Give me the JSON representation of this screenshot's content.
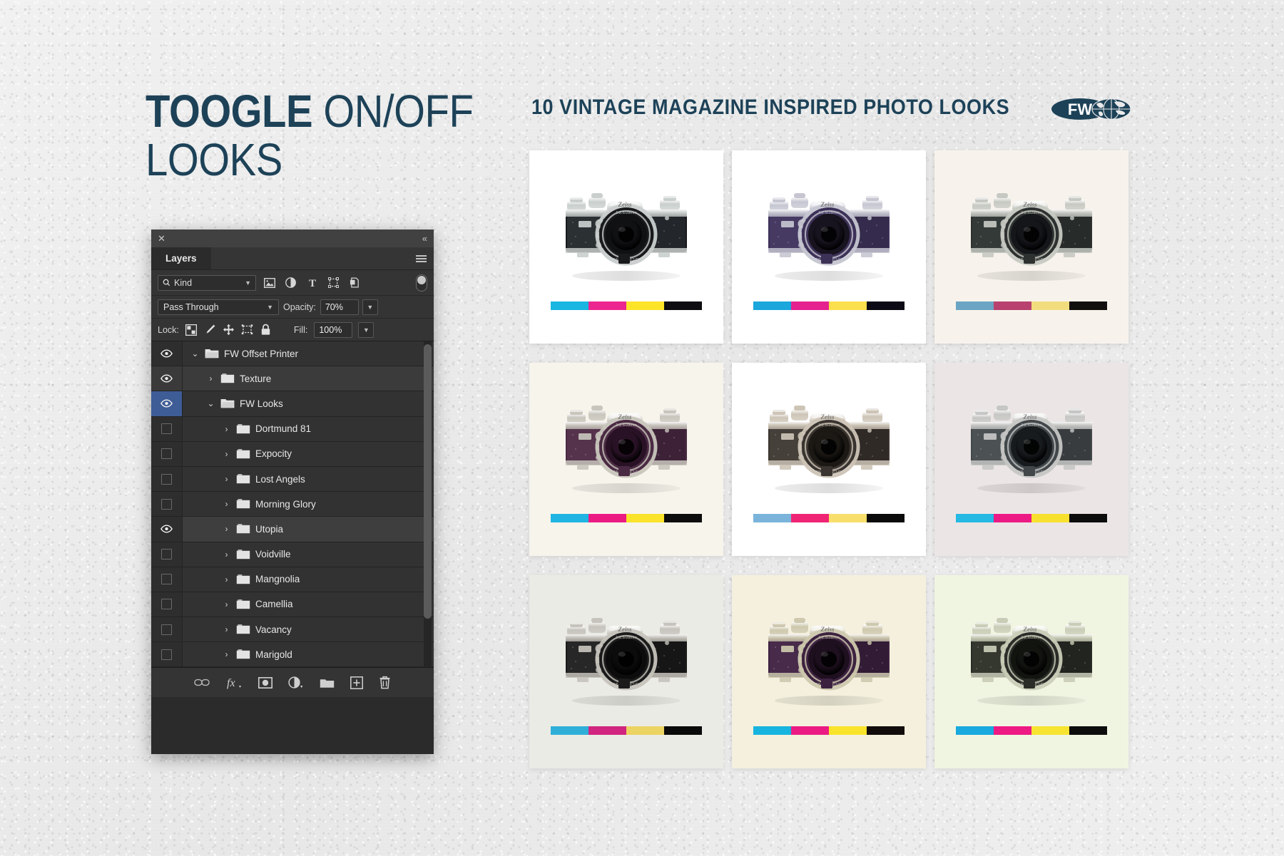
{
  "headline": {
    "bold": "TOOGLE",
    "light": "ON/OFF",
    "line2": "LOOKS"
  },
  "subtitle": "10 VINTAGE MAGAZINE  INSPIRED PHOTO LOOKS",
  "logo": {
    "text": "FW",
    "icon": "globe-icon"
  },
  "colors": {
    "navy": "#1d4258",
    "panel_bg": "#2b2b2b",
    "row_bg": "#323232",
    "row_selected": "#3e3e3e",
    "eye_active_blue": "#3e5c96",
    "canvas_bg": "#ececec"
  },
  "panel": {
    "title": "Layers",
    "close_icon": "close-icon",
    "collapse_icon": "double-chevron-left-icon",
    "menu_icon": "panel-menu-icon",
    "filter": {
      "kind_label": "Kind",
      "search_icon": "search-icon",
      "caret_icon": "chevron-down-icon",
      "icons": [
        "pixel-layer-icon",
        "adjustment-layer-icon",
        "type-layer-icon",
        "shape-layer-icon",
        "smart-object-icon"
      ],
      "toggle_icon": "filter-toggle-icon"
    },
    "blend": {
      "mode": "Pass Through",
      "opacity_label": "Opacity:",
      "opacity_value": "70%"
    },
    "lock": {
      "label": "Lock:",
      "icons": [
        "lock-transparency-icon",
        "lock-image-icon",
        "lock-position-icon",
        "lock-artboard-icon",
        "lock-all-icon"
      ],
      "fill_label": "Fill:",
      "fill_value": "100%"
    },
    "layers": [
      {
        "name": "FW Offset Printer",
        "indent": 0,
        "expanded": true,
        "visible": true,
        "eye_state": "on",
        "row": "normal"
      },
      {
        "name": "Texture",
        "indent": 1,
        "expanded": false,
        "visible": true,
        "eye_state": "on",
        "row": "lighter"
      },
      {
        "name": "FW Looks",
        "indent": 1,
        "expanded": true,
        "visible": true,
        "eye_state": "active",
        "row": "normal"
      },
      {
        "name": "Dortmund 81",
        "indent": 2,
        "expanded": false,
        "visible": false,
        "eye_state": "off",
        "row": "normal"
      },
      {
        "name": "Expocity",
        "indent": 2,
        "expanded": false,
        "visible": false,
        "eye_state": "off",
        "row": "normal"
      },
      {
        "name": "Lost Angels",
        "indent": 2,
        "expanded": false,
        "visible": false,
        "eye_state": "off",
        "row": "normal"
      },
      {
        "name": "Morning Glory",
        "indent": 2,
        "expanded": false,
        "visible": false,
        "eye_state": "off",
        "row": "normal"
      },
      {
        "name": "Utopia",
        "indent": 2,
        "expanded": false,
        "visible": true,
        "eye_state": "on",
        "row": "selected"
      },
      {
        "name": "Voidville",
        "indent": 2,
        "expanded": false,
        "visible": false,
        "eye_state": "off",
        "row": "normal"
      },
      {
        "name": "Mangnolia",
        "indent": 2,
        "expanded": false,
        "visible": false,
        "eye_state": "off",
        "row": "normal"
      },
      {
        "name": "Camellia",
        "indent": 2,
        "expanded": false,
        "visible": false,
        "eye_state": "off",
        "row": "normal"
      },
      {
        "name": "Vacancy",
        "indent": 2,
        "expanded": false,
        "visible": false,
        "eye_state": "off",
        "row": "normal"
      },
      {
        "name": "Marigold",
        "indent": 2,
        "expanded": false,
        "visible": false,
        "eye_state": "off",
        "row": "normal"
      }
    ],
    "bottom_icons": [
      "link-layers-icon",
      "layer-style-fx-icon",
      "layer-mask-icon",
      "adjustment-layer-icon",
      "new-group-icon",
      "new-layer-icon",
      "delete-layer-icon"
    ]
  },
  "grid": {
    "columns": 3,
    "rows": 3,
    "thumbnails": [
      {
        "id": "look-1",
        "bg": "#ffffff",
        "body": "#191a1c",
        "leather": "#2b3033",
        "grip": "#23262a",
        "top": "#c9cfcd",
        "lens": "#101113",
        "bars": [
          "#18b6e0",
          "#ec268f",
          "#fde428",
          "#0d0d12"
        ]
      },
      {
        "id": "look-2",
        "bg": "#ffffff",
        "body": "#3c3157",
        "leather": "#463a63",
        "grip": "#352b4c",
        "top": "#c5c6d1",
        "lens": "#17131f",
        "bars": [
          "#1ba6dc",
          "#e5218f",
          "#fbdf4d",
          "#0c0a14"
        ]
      },
      {
        "id": "look-3",
        "bg": "#f7f3ec",
        "body": "#2d3230",
        "leather": "#343a38",
        "grip": "#272c2b",
        "top": "#c6c9c2",
        "lens": "#14161a",
        "bars": [
          "#6ca5c4",
          "#b8416f",
          "#f2dd7e",
          "#12100e"
        ]
      },
      {
        "id": "look-4",
        "bg": "#f7f4ec",
        "body": "#4a2a43",
        "leather": "#55334c",
        "grip": "#3d2237",
        "top": "#c8c5bc",
        "lens": "#2a1226",
        "bars": [
          "#20b4e2",
          "#ec1b84",
          "#fae32a",
          "#0d0d0d"
        ]
      },
      {
        "id": "look-5",
        "bg": "#ffffff",
        "body": "#3a3430",
        "leather": "#46403a",
        "grip": "#2f2a26",
        "top": "#cdc4b6",
        "lens": "#1c1814",
        "bars": [
          "#7ab4da",
          "#ef2474",
          "#f8df6b",
          "#0b0b0b"
        ]
      },
      {
        "id": "look-6",
        "bg": "#ece5e5",
        "body": "#42474a",
        "leather": "#4c5154",
        "grip": "#383c3f",
        "top": "#c6c7c5",
        "lens": "#181b1e",
        "bars": [
          "#25b9e3",
          "#ec1a85",
          "#f7e02e",
          "#0c0c0c"
        ]
      },
      {
        "id": "look-7",
        "bg": "#ebebe5",
        "body": "#1b1b1b",
        "leather": "#272727",
        "grip": "#161616",
        "top": "#c5c3bb",
        "lens": "#0c0c0c",
        "bars": [
          "#2fafd8",
          "#d1257f",
          "#ecd462",
          "#0a0a0a"
        ]
      },
      {
        "id": "look-8",
        "bg": "#f4f0dd",
        "body": "#3d2240",
        "leather": "#482a4b",
        "grip": "#321b35",
        "top": "#cdc8ae",
        "lens": "#1f1020",
        "bars": [
          "#17b4df",
          "#ec1b84",
          "#fae42b",
          "#120c0c"
        ]
      },
      {
        "id": "look-9",
        "bg": "#f0f5e2",
        "body": "#2a2c28",
        "leather": "#35382f",
        "grip": "#222420",
        "top": "#c9cdb7",
        "lens": "#121410",
        "bars": [
          "#18a9df",
          "#ee1a84",
          "#f7e431",
          "#0d0d0d"
        ]
      }
    ]
  }
}
